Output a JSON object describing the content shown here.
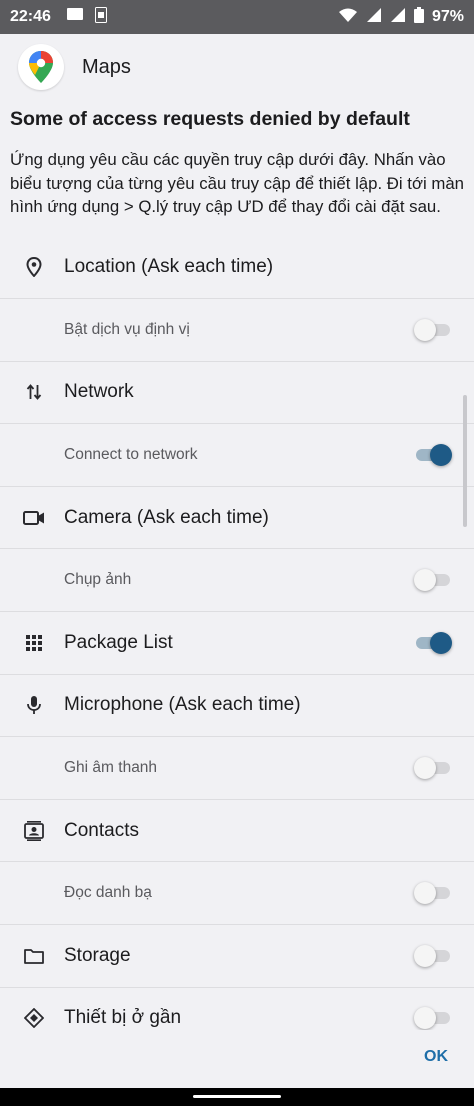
{
  "status_bar": {
    "time": "22:46",
    "battery": "97%",
    "icons": [
      "gallery-icon",
      "notification-icon",
      "wifi-icon",
      "signal-icon",
      "signal-icon",
      "battery-icon"
    ]
  },
  "app": {
    "name": "Maps",
    "icon": "google-maps-pin-icon"
  },
  "section_title": "Some of access requests denied by default",
  "description": "Ứng dụng yêu cầu các quyền truy cập dưới đây. Nhấn vào biểu tượng của từng yêu cầu truy cập để thiết lập. Đi tới màn hình ứng dụng > Q.lý truy cập ƯD để thay đổi cài đặt sau.",
  "permissions": [
    {
      "label": "Location (Ask each time)",
      "icon": "location-pin-icon"
    },
    {
      "label": "Bật dịch vụ định vị",
      "toggle": false
    },
    {
      "label": "Network",
      "icon": "swap-vertical-arrows-icon"
    },
    {
      "label": "Connect to network",
      "toggle": true
    },
    {
      "label": "Camera (Ask each time)",
      "icon": "video-camera-icon"
    },
    {
      "label": "Chụp ảnh",
      "toggle": false
    },
    {
      "label": "Package List",
      "icon": "grid-dots-icon",
      "toggle": true
    },
    {
      "label": "Microphone (Ask each time)",
      "icon": "microphone-icon"
    },
    {
      "label": "Ghi âm thanh",
      "toggle": false
    },
    {
      "label": "Contacts",
      "icon": "contact-card-icon"
    },
    {
      "label": "Đọc danh bạ",
      "toggle": false
    },
    {
      "label": "Storage",
      "icon": "folder-icon",
      "toggle": false
    },
    {
      "label": "Thiết bị ở gần",
      "icon": "nearby-diamond-icon",
      "toggle": false
    }
  ],
  "ok_label": "OK",
  "colors": {
    "accent": "#1e5a86",
    "ok_text": "#1e6ea8",
    "background": "#f1f1f4",
    "status_bar": "#5b5b5e"
  }
}
